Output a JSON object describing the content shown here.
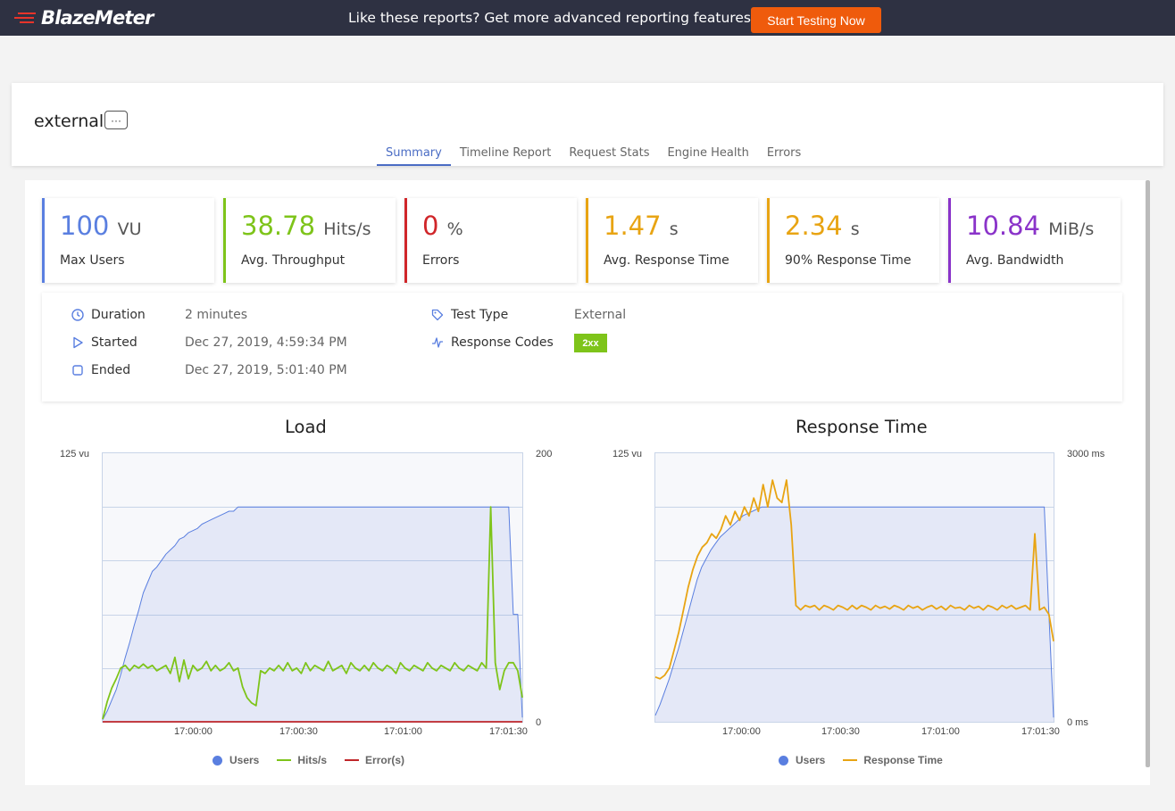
{
  "topbar": {
    "brand": "BlazeMeter",
    "promo_text": "Like these reports? Get more advanced reporting features",
    "cta_label": "Start Testing Now"
  },
  "report": {
    "name": "external",
    "more_label": "···",
    "tabs": [
      "Summary",
      "Timeline Report",
      "Request Stats",
      "Engine Health",
      "Errors"
    ],
    "active_tab": "Summary"
  },
  "kpis": [
    {
      "value": "100",
      "unit": "VU",
      "label": "Max Users",
      "color": "#5a7fe0"
    },
    {
      "value": "38.78",
      "unit": "Hits/s",
      "label": "Avg. Throughput",
      "color": "#7ec41a"
    },
    {
      "value": "0",
      "unit": "%",
      "label": "Errors",
      "color": "#d0262a"
    },
    {
      "value": "1.47",
      "unit": "s",
      "label": "Avg. Response Time",
      "color": "#e8a413"
    },
    {
      "value": "2.34",
      "unit": "s",
      "label": "90% Response Time",
      "color": "#e8a413"
    },
    {
      "value": "10.84",
      "unit": "MiB/s",
      "label": "Avg. Bandwidth",
      "color": "#8a33c9"
    }
  ],
  "info": {
    "duration_label": "Duration",
    "duration_value": "2 minutes",
    "started_label": "Started",
    "started_value": "Dec 27, 2019, 4:59:34 PM",
    "ended_label": "Ended",
    "ended_value": "Dec 27, 2019, 5:01:40 PM",
    "test_type_label": "Test Type",
    "test_type_value": "External",
    "response_codes_label": "Response Codes",
    "response_codes_value": "2xx"
  },
  "chart_data": [
    {
      "type": "line",
      "title": "Load",
      "x_ticks": [
        "17:00:00",
        "17:00:30",
        "17:01:00",
        "17:01:30"
      ],
      "y_left_top": "125 vu",
      "y_right_top": "200",
      "y_right_bottom": "0",
      "ylim_left": [
        0,
        125
      ],
      "ylim_right": [
        0,
        200
      ],
      "series": [
        {
          "name": "Users",
          "color": "#5a7fe0",
          "axis": "left",
          "values": [
            1,
            5,
            10,
            15,
            22,
            30,
            37,
            45,
            52,
            60,
            65,
            70,
            72,
            75,
            78,
            80,
            82,
            85,
            86,
            88,
            89,
            90,
            92,
            93,
            94,
            95,
            96,
            97,
            98,
            98,
            100,
            100,
            100,
            100,
            100,
            100,
            100,
            100,
            100,
            100,
            100,
            100,
            100,
            100,
            100,
            100,
            100,
            100,
            100,
            100,
            100,
            100,
            100,
            100,
            100,
            100,
            100,
            100,
            100,
            100,
            100,
            100,
            100,
            100,
            100,
            100,
            100,
            100,
            100,
            100,
            100,
            100,
            100,
            100,
            100,
            100,
            100,
            100,
            100,
            100,
            100,
            100,
            100,
            100,
            100,
            100,
            100,
            100,
            100,
            100,
            100,
            50,
            50,
            2
          ]
        },
        {
          "name": "Hits/s",
          "color": "#7ec41a",
          "axis": "right",
          "values": [
            2,
            15,
            25,
            32,
            40,
            42,
            38,
            42,
            40,
            43,
            40,
            42,
            38,
            40,
            42,
            36,
            48,
            30,
            46,
            32,
            42,
            38,
            40,
            45,
            38,
            42,
            38,
            40,
            44,
            38,
            40,
            26,
            18,
            14,
            12,
            38,
            36,
            40,
            38,
            42,
            38,
            44,
            38,
            40,
            36,
            44,
            38,
            42,
            40,
            38,
            45,
            38,
            40,
            42,
            36,
            44,
            40,
            38,
            42,
            38,
            44,
            40,
            38,
            42,
            40,
            36,
            44,
            40,
            38,
            42,
            40,
            38,
            44,
            40,
            38,
            42,
            40,
            38,
            44,
            40,
            38,
            42,
            40,
            38,
            44,
            40,
            160,
            44,
            24,
            38,
            44,
            44,
            38,
            18
          ]
        },
        {
          "name": "Error(s)",
          "color": "#c0262a",
          "axis": "right",
          "values": [
            0,
            0,
            0,
            0,
            0,
            0,
            0,
            0,
            0,
            0,
            0,
            0,
            0,
            0,
            0,
            0,
            0,
            0,
            0,
            0,
            0,
            0,
            0,
            0,
            0,
            0,
            0,
            0,
            0,
            0,
            0,
            0,
            0,
            0,
            0,
            0,
            0,
            0,
            0,
            0,
            0,
            0,
            0,
            0,
            0,
            0,
            0,
            0,
            0,
            0,
            0,
            0,
            0,
            0,
            0,
            0,
            0,
            0,
            0,
            0,
            0,
            0,
            0,
            0,
            0,
            0,
            0,
            0,
            0,
            0,
            0,
            0,
            0,
            0,
            0,
            0,
            0,
            0,
            0,
            0,
            0,
            0,
            0,
            0,
            0,
            0,
            0,
            0,
            0,
            0,
            0,
            0,
            0,
            0
          ]
        }
      ]
    },
    {
      "type": "line",
      "title": "Response Time",
      "x_ticks": [
        "17:00:00",
        "17:00:30",
        "17:01:00",
        "17:01:30"
      ],
      "y_left_top": "125 vu",
      "y_right_top": "3000 ms",
      "y_right_bottom": "0 ms",
      "ylim_left": [
        0,
        125
      ],
      "ylim_right": [
        0,
        3000
      ],
      "series": [
        {
          "name": "Users",
          "color": "#5a7fe0",
          "axis": "left",
          "values": [
            3,
            8,
            14,
            20,
            27,
            34,
            42,
            50,
            58,
            66,
            72,
            76,
            80,
            83,
            86,
            88,
            90,
            92,
            94,
            96,
            97,
            98,
            99,
            100,
            100,
            100,
            100,
            100,
            100,
            100,
            100,
            100,
            100,
            100,
            100,
            100,
            100,
            100,
            100,
            100,
            100,
            100,
            100,
            100,
            100,
            100,
            100,
            100,
            100,
            100,
            100,
            100,
            100,
            100,
            100,
            100,
            100,
            100,
            100,
            100,
            100,
            100,
            100,
            100,
            100,
            100,
            100,
            100,
            100,
            100,
            100,
            100,
            100,
            100,
            100,
            100,
            100,
            100,
            100,
            100,
            100,
            100,
            100,
            100,
            100,
            50,
            2
          ]
        },
        {
          "name": "Response Time",
          "color": "#e8a413",
          "axis": "right",
          "values": [
            500,
            480,
            520,
            600,
            800,
            1000,
            1250,
            1500,
            1700,
            1850,
            1950,
            2000,
            2100,
            2050,
            2150,
            2300,
            2200,
            2350,
            2250,
            2400,
            2300,
            2500,
            2350,
            2650,
            2400,
            2700,
            2500,
            2450,
            2700,
            2200,
            1300,
            1250,
            1300,
            1280,
            1300,
            1250,
            1300,
            1280,
            1250,
            1300,
            1280,
            1250,
            1300,
            1260,
            1300,
            1280,
            1250,
            1300,
            1270,
            1290,
            1260,
            1300,
            1280,
            1250,
            1300,
            1270,
            1290,
            1250,
            1280,
            1300,
            1260,
            1290,
            1250,
            1300,
            1270,
            1280,
            1250,
            1300,
            1270,
            1290,
            1250,
            1300,
            1280,
            1250,
            1300,
            1270,
            1300,
            1260,
            1280,
            1300,
            1250,
            2100,
            1250,
            1280,
            1200,
            900
          ]
        }
      ]
    }
  ],
  "legend": {
    "load": [
      "Users",
      "Hits/s",
      "Error(s)"
    ],
    "response": [
      "Users",
      "Response Time"
    ]
  }
}
